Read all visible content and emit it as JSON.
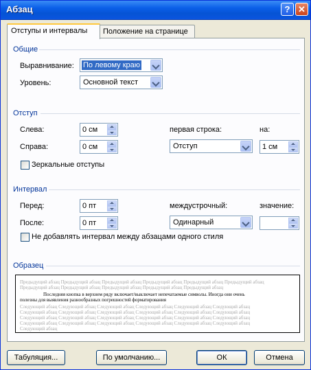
{
  "window": {
    "title": "Абзац",
    "help_glyph": "?",
    "close_glyph": "✕"
  },
  "tabs": [
    {
      "label": "Отступы и интервалы",
      "active": true
    },
    {
      "label": "Положение на странице",
      "active": false
    }
  ],
  "general": {
    "title": "Общие",
    "alignment_label": "Выравнивание:",
    "alignment_value": "По левому краю",
    "level_label": "Уровень:",
    "level_value": "Основной текст"
  },
  "indent": {
    "title": "Отступ",
    "left_label": "Слева:",
    "left_value": "0 см",
    "right_label": "Справа:",
    "right_value": "0 см",
    "first_line_label": "первая строка:",
    "first_line_value": "Отступ",
    "by_label": "на:",
    "by_value": "1 см",
    "mirror_label": "Зеркальные отступы",
    "mirror_checked": false
  },
  "spacing": {
    "title": "Интервал",
    "before_label": "Перед:",
    "before_value": "0 пт",
    "after_label": "После:",
    "after_value": "0 пт",
    "line_label": "междустрочный:",
    "line_value": "Одинарный",
    "at_label": "значение:",
    "at_value": "",
    "no_space_label": "Не добавлять интервал между абзацами одного стиля",
    "no_space_checked": false
  },
  "preview": {
    "title": "Образец",
    "lines": [
      "Предыдущий абзац Предыдущий абзац Предыдущий абзац Предыдущий абзац Предыдущий абзац Предыдущий абзац",
      "Предыдущий абзац Предыдущий абзац Предыдущий абзац Предыдущий абзац Предыдущий абзац",
      "Последняя кнопка в верхнем ряду включает/выключает непечатаемые символы. Иногда они очень",
      "полезны для выявления разнообразных погрешностей форматирования",
      "Следующий абзац Следующий абзац Следующий абзац Следующий абзац Следующий абзац Следующий абзац",
      "Следующий абзац Следующий абзац Следующий абзац Следующий абзац Следующий абзац Следующий абзац",
      "Следующий абзац Следующий абзац Следующий абзац Следующий абзац Следующий абзац Следующий абзац",
      "Следующий абзац Следующий абзац Следующий абзац Следующий абзац Следующий абзац Следующий абзац",
      "Следующий абзац"
    ]
  },
  "buttons": {
    "tabs": "Табуляция...",
    "default": "По умолчанию...",
    "ok": "ОК",
    "cancel": "Отмена"
  },
  "colors": {
    "title_bar": "#0a5fe8",
    "section_title": "#003399",
    "selection": "#316ac5",
    "dialog_bg": "#ece9d8"
  }
}
